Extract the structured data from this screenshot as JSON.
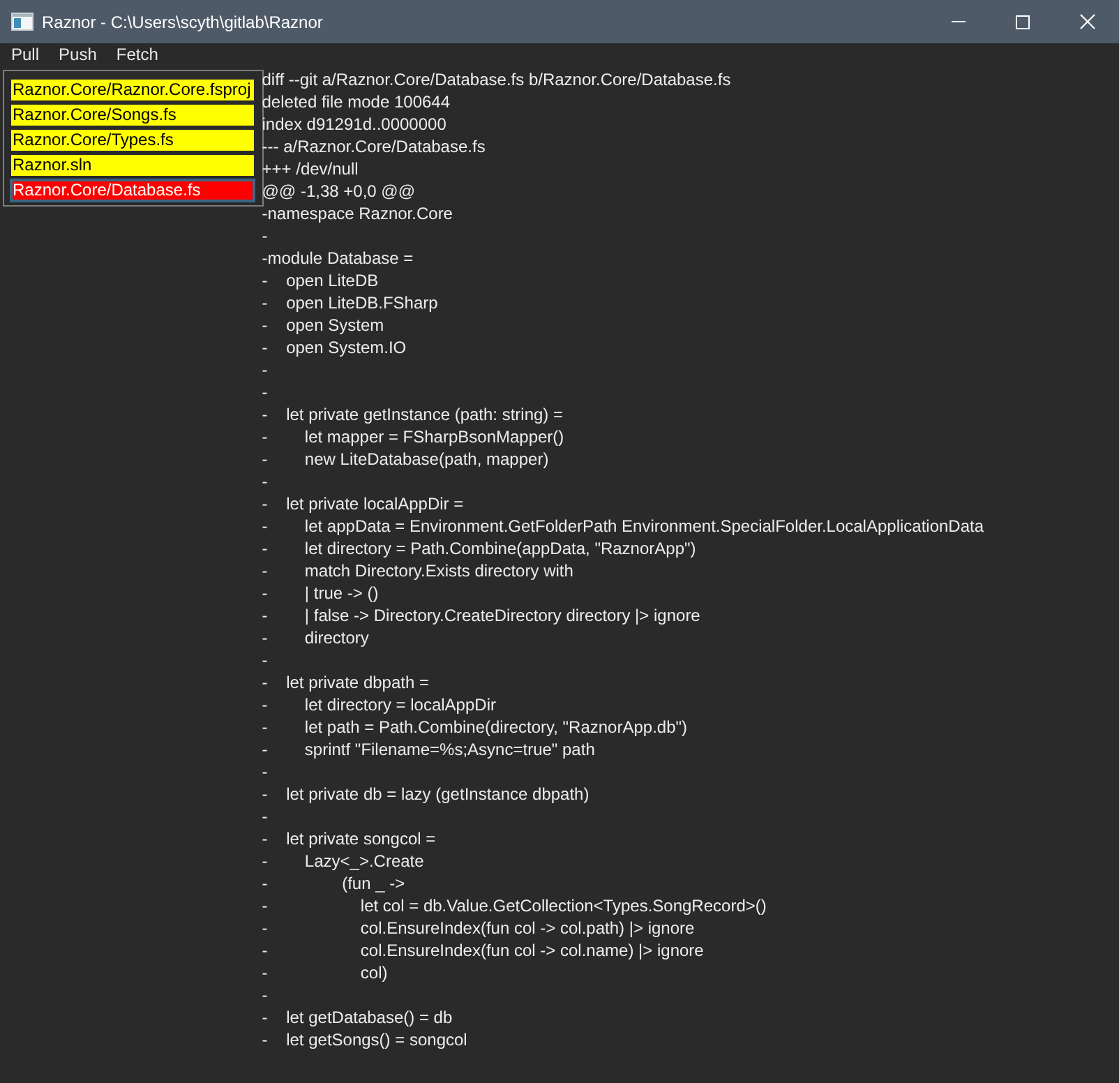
{
  "window": {
    "title": "Raznor - C:\\Users\\scyth\\gitlab\\Raznor"
  },
  "menu": [
    "Pull",
    "Push",
    "Fetch"
  ],
  "files": [
    {
      "name": "Raznor.Core/Raznor.Core.fsproj",
      "color": "#ffff00",
      "selected": false
    },
    {
      "name": "Raznor.Core/Songs.fs",
      "color": "#ffff00",
      "selected": false
    },
    {
      "name": "Raznor.Core/Types.fs",
      "color": "#ffff00",
      "selected": false
    },
    {
      "name": "Raznor.sln",
      "color": "#ffff00",
      "selected": false
    },
    {
      "name": "Raznor.Core/Database.fs",
      "color": "#ff0000",
      "selected": true
    }
  ],
  "diff": {
    "lines": [
      "diff --git a/Raznor.Core/Database.fs b/Raznor.Core/Database.fs",
      "deleted file mode 100644",
      "index d91291d..0000000",
      "--- a/Raznor.Core/Database.fs",
      "+++ /dev/null",
      "@@ -1,38 +0,0 @@",
      "-namespace Raznor.Core",
      "-",
      "-module Database =",
      "-    open LiteDB",
      "-    open LiteDB.FSharp",
      "-    open System",
      "-    open System.IO",
      "-",
      "-",
      "-    let private getInstance (path: string) =",
      "-        let mapper = FSharpBsonMapper()",
      "-        new LiteDatabase(path, mapper)",
      "-",
      "-    let private localAppDir =",
      "-        let appData = Environment.GetFolderPath Environment.SpecialFolder.LocalApplicationData",
      "-        let directory = Path.Combine(appData, \"RaznorApp\")",
      "-        match Directory.Exists directory with",
      "-        | true -> ()",
      "-        | false -> Directory.CreateDirectory directory |> ignore",
      "-        directory",
      "-",
      "-    let private dbpath =",
      "-        let directory = localAppDir",
      "-        let path = Path.Combine(directory, \"RaznorApp.db\")",
      "-        sprintf \"Filename=%s;Async=true\" path",
      "-",
      "-    let private db = lazy (getInstance dbpath)",
      "-",
      "-    let private songcol =",
      "-        Lazy<_>.Create",
      "-                (fun _ ->",
      "-                    let col = db.Value.GetCollection<Types.SongRecord>()",
      "-                    col.EnsureIndex(fun col -> col.path) |> ignore",
      "-                    col.EnsureIndex(fun col -> col.name) |> ignore",
      "-                    col)",
      "-",
      "-    let getDatabase() = db",
      "-    let getSongs() = songcol"
    ]
  }
}
